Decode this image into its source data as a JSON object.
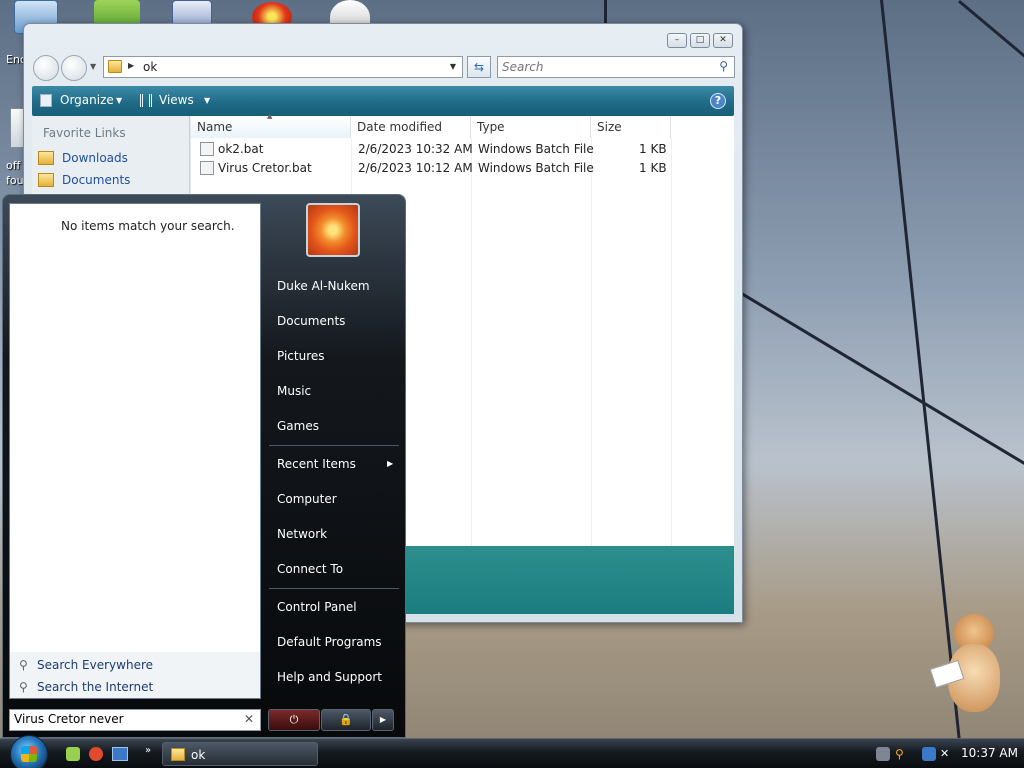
{
  "desktop": {
    "label_left_top": "Enc",
    "label_left_mid": "off\nfou"
  },
  "explorer": {
    "address": "ok",
    "search_placeholder": "Search",
    "toolbar": {
      "organize": "Organize",
      "views": "Views"
    },
    "nav": {
      "header": "Favorite Links",
      "links": [
        "Downloads",
        "Documents"
      ]
    },
    "columns": [
      "Name",
      "Date modified",
      "Type",
      "Size"
    ],
    "files": [
      {
        "name": "ok2.bat",
        "date": "2/6/2023 10:32 AM",
        "type": "Windows Batch File",
        "size": "1 KB"
      },
      {
        "name": "Virus Cretor.bat",
        "date": "2/6/2023 10:12 AM",
        "type": "Windows Batch File",
        "size": "1 KB"
      }
    ]
  },
  "startmenu": {
    "no_results": "No items match your search.",
    "search_everywhere": "Search Everywhere",
    "search_internet": "Search the Internet",
    "search_value": "Virus Cretor never",
    "right_items": [
      "Duke Al-Nukem",
      "Documents",
      "Pictures",
      "Music",
      "Games",
      "Recent Items",
      "Computer",
      "Network",
      "Connect To",
      "Control Panel",
      "Default Programs",
      "Help and Support"
    ]
  },
  "taskbar": {
    "window_button": "ok",
    "clock": "10:37 AM"
  }
}
